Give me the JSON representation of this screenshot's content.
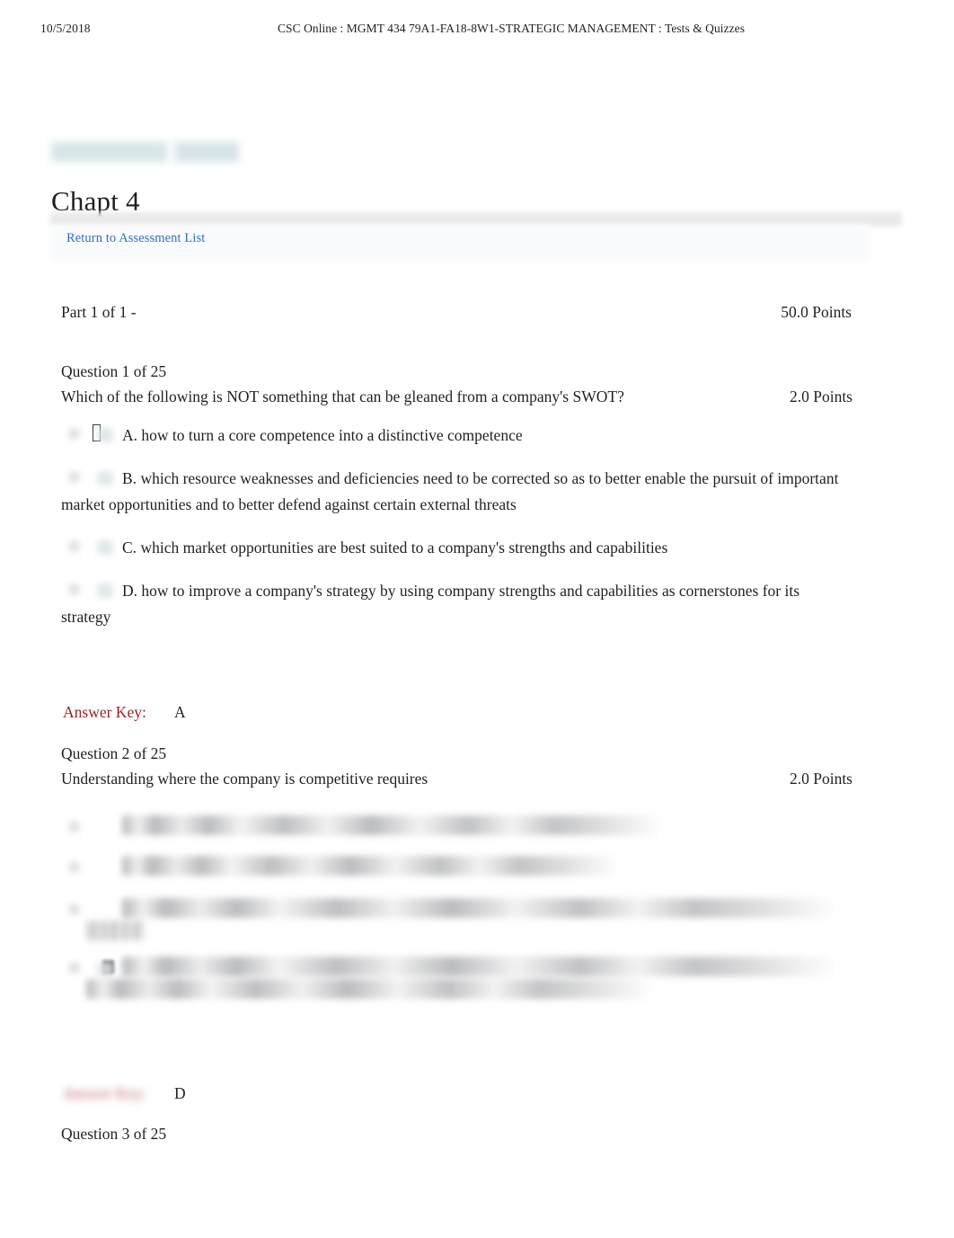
{
  "print_header": {
    "date": "10/5/2018",
    "document_title": "CSC Online : MGMT 434 79A1-FA18-8W1-STRATEGIC MANAGEMENT : Tests & Quizzes"
  },
  "colors": {
    "link": "#2f6fc0",
    "answer_key": "#9b2222",
    "text": "#231f20",
    "toolbar_band": "#e9e9e9"
  },
  "breadcrumb": {
    "redacted": true,
    "label": ""
  },
  "page_title": "Chapt 4",
  "toolbar": {
    "return_link": "Return to Assessment List"
  },
  "part": {
    "label": "Part 1 of 1 -",
    "points": "50.0 Points"
  },
  "questions": [
    {
      "number": "Question 1 of 25",
      "text": "Which of the following is NOT something that can be gleaned from a company's SWOT?",
      "points": "2.0 Points",
      "redacted": false,
      "options": [
        {
          "letter": "A.",
          "text": "how to turn a core competence into a distinctive competence",
          "selected": true,
          "redacted": false
        },
        {
          "letter": "B.",
          "text": "which resource weaknesses and deficiencies need to be corrected so as to better enable the pursuit of important market opportunities and to better defend against certain external threats",
          "selected": false,
          "redacted": false
        },
        {
          "letter": "C.",
          "text": "which market opportunities are best suited to a company's strengths and capabilities",
          "selected": false,
          "redacted": false
        },
        {
          "letter": "D.",
          "text": "how to improve a company's strategy by using company strengths and capabilities as cornerstones for its strategy",
          "selected": false,
          "redacted": false
        }
      ],
      "answer_key": {
        "label": "Answer Key:",
        "value": "A",
        "label_redacted": false
      }
    },
    {
      "number": "Question 2 of 25",
      "text": "Understanding where the company is competitive requires",
      "points": "2.0 Points",
      "redacted": true,
      "options": [
        {
          "letter": "A.",
          "text": "",
          "selected": false,
          "redacted": true
        },
        {
          "letter": "B.",
          "text": "",
          "selected": false,
          "redacted": true
        },
        {
          "letter": "C.",
          "text": "",
          "selected": false,
          "redacted": true
        },
        {
          "letter": "D.",
          "text": "",
          "selected": true,
          "redacted": true
        }
      ],
      "answer_key": {
        "label": "Answer Key:",
        "value": "D",
        "label_redacted": true
      }
    },
    {
      "number": "Question 3 of 25",
      "text": "",
      "points": "",
      "redacted": false,
      "options": [],
      "answer_key": null
    }
  ]
}
